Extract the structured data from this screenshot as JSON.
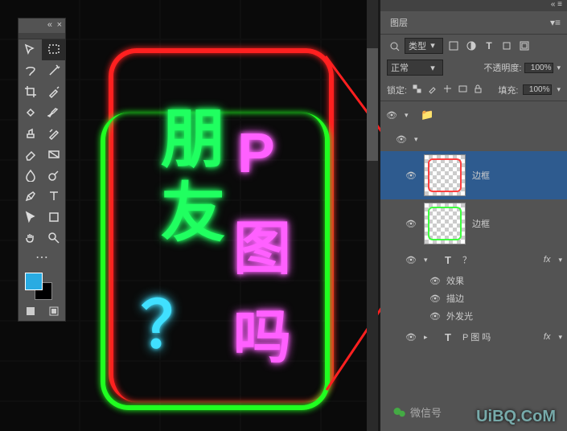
{
  "toolbar": {
    "fg_color": "#29abe2",
    "bg_color": "#000000"
  },
  "canvas": {
    "text_green": "朋友",
    "text_pink_p": "P",
    "text_pink_tu": "图",
    "text_pink_ma": "吗",
    "text_cyan": "？"
  },
  "panel": {
    "tab": "图层",
    "kind_label": "类型",
    "blend_mode": "正常",
    "opacity_label": "不透明度:",
    "opacity_value": "100%",
    "lock_label": "锁定:",
    "fill_label": "填充:",
    "fill_value": "100%",
    "layers": [
      {
        "name": "边框",
        "type": "thumb-red"
      },
      {
        "name": "边框",
        "type": "thumb-green"
      },
      {
        "name": "？",
        "type": "text",
        "fx": "fx"
      },
      {
        "name": "P 图 吗",
        "type": "text",
        "fx": "fx"
      }
    ],
    "fx_label": "效果",
    "fx_stroke": "描边",
    "fx_glow": "外发光"
  },
  "watermark": {
    "site": "UiBQ.CoM",
    "wx_label": "微信号"
  },
  "chart_data": null
}
